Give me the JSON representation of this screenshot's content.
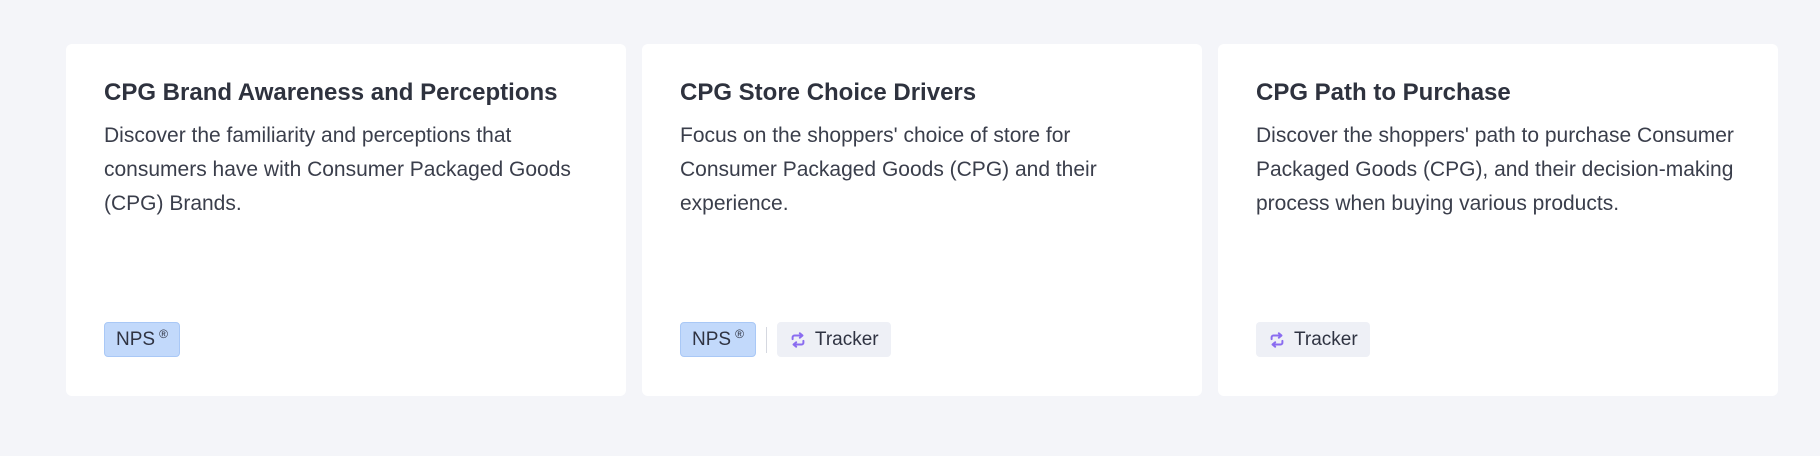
{
  "cards": [
    {
      "title": "CPG Brand Awareness and Perceptions",
      "description": "Discover the familiarity and perceptions that consumers have with Consumer Packaged Goods (CPG) Brands.",
      "tags": {
        "nps": "NPS",
        "nps_mark": "®"
      }
    },
    {
      "title": "CPG Store Choice Drivers",
      "description": "Focus on the shoppers' choice of store for Consumer Packaged Goods (CPG) and their experience.",
      "tags": {
        "nps": "NPS",
        "nps_mark": "®",
        "tracker": "Tracker"
      }
    },
    {
      "title": "CPG Path to Purchase",
      "description": "Discover the shoppers' path to purchase Consumer Packaged Goods (CPG), and their decision-making process when buying various products.",
      "tags": {
        "tracker": "Tracker"
      }
    }
  ],
  "icons": {
    "tracker": "repeat-icon"
  },
  "colors": {
    "background": "#f4f5f9",
    "card": "#ffffff",
    "nps_tag": "#c2d9fb",
    "tracker_tag": "#eef0f6",
    "tracker_icon": "#8a6cf0"
  }
}
